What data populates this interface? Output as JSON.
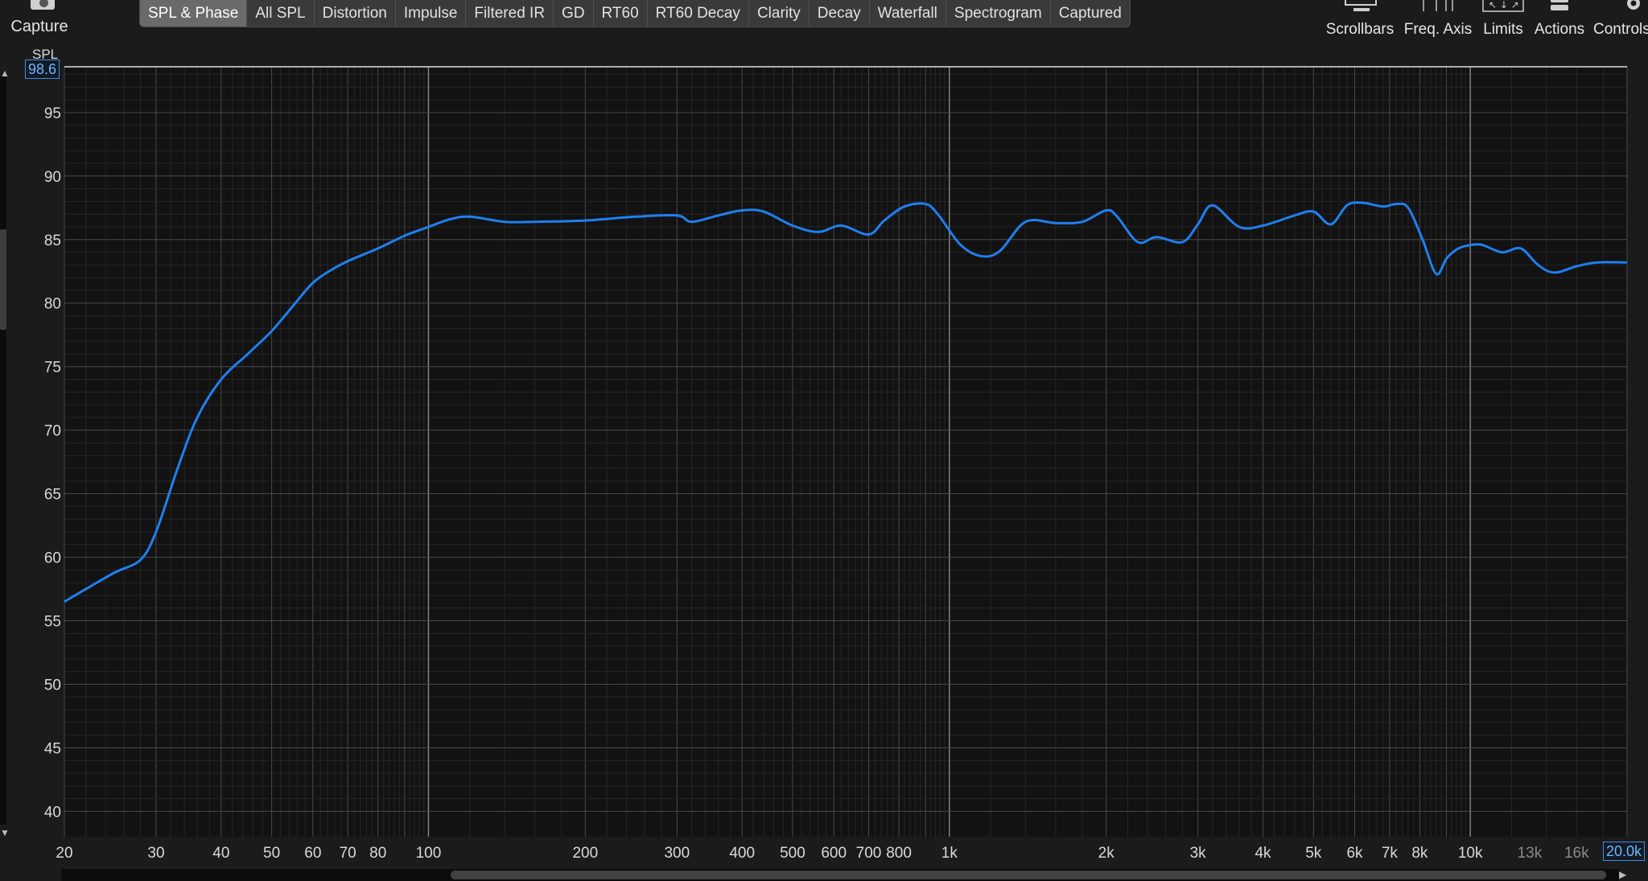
{
  "toolbar": {
    "capture_label": "Capture",
    "tabs": [
      {
        "label": "SPL & Phase",
        "active": true
      },
      {
        "label": "All SPL",
        "active": false
      },
      {
        "label": "Distortion",
        "active": false
      },
      {
        "label": "Impulse",
        "active": false
      },
      {
        "label": "Filtered IR",
        "active": false
      },
      {
        "label": "GD",
        "active": false
      },
      {
        "label": "RT60",
        "active": false
      },
      {
        "label": "RT60 Decay",
        "active": false
      },
      {
        "label": "Clarity",
        "active": false
      },
      {
        "label": "Decay",
        "active": false
      },
      {
        "label": "Waterfall",
        "active": false
      },
      {
        "label": "Spectrogram",
        "active": false
      },
      {
        "label": "Captured",
        "active": false
      }
    ],
    "right_tools": {
      "scrollbars": "Scrollbars",
      "freq_axis": "Freq. Axis",
      "limits": "Limits",
      "actions": "Actions",
      "controls": "Controls"
    }
  },
  "graph": {
    "y_axis_title": "SPL",
    "y_max_value": "98.6",
    "x_max_value": "20.0k",
    "y_tick_labels": [
      "95",
      "90",
      "85",
      "80",
      "75",
      "70",
      "65",
      "60",
      "55",
      "50",
      "45",
      "40"
    ],
    "x_tick_labels": [
      "20",
      "30",
      "40",
      "50",
      "60",
      "70",
      "80",
      "100",
      "200",
      "300",
      "400",
      "500",
      "600",
      "700",
      "800",
      "1k",
      "2k",
      "3k",
      "4k",
      "5k",
      "6k",
      "7k",
      "8k",
      "10k",
      "13k",
      "16k"
    ],
    "colors": {
      "background": "#121212",
      "trace": "#1f7ff0",
      "grid_major": "#4a4a4a",
      "grid_minor": "#262626"
    }
  },
  "chart_data": {
    "type": "line",
    "x_scale": "log",
    "xlim": [
      20,
      20000
    ],
    "ylim": [
      38,
      98.6
    ],
    "grid": true,
    "xlabel": "",
    "ylabel": "SPL",
    "series": [
      {
        "x": [
          20,
          22,
          25,
          28,
          30,
          33,
          36,
          40,
          45,
          50,
          55,
          60,
          65,
          70,
          80,
          90,
          100,
          110,
          120,
          140,
          160,
          200,
          250,
          300,
          320,
          360,
          400,
          440,
          500,
          560,
          620,
          700,
          750,
          820,
          900,
          950,
          1050,
          1150,
          1250,
          1400,
          1600,
          1800,
          2000,
          2100,
          2300,
          2500,
          2800,
          3000,
          3200,
          3600,
          4000,
          4600,
          5000,
          5400,
          5800,
          6200,
          6800,
          7200,
          7600,
          8100,
          8600,
          9000,
          9400,
          9800,
          10500,
          11500,
          12500,
          13500,
          14500,
          16000,
          17500,
          20000
        ],
        "y": [
          56.5,
          57.5,
          58.8,
          59.8,
          62.0,
          67.0,
          71.0,
          74.0,
          76.0,
          77.8,
          79.8,
          81.6,
          82.6,
          83.3,
          84.3,
          85.3,
          86.0,
          86.6,
          86.8,
          86.4,
          86.4,
          86.5,
          86.8,
          86.9,
          86.4,
          86.9,
          87.3,
          87.2,
          86.1,
          85.6,
          86.1,
          85.4,
          86.5,
          87.6,
          87.8,
          87.0,
          84.6,
          83.7,
          84.1,
          86.4,
          86.3,
          86.4,
          87.3,
          86.8,
          84.8,
          85.2,
          84.8,
          86.2,
          87.7,
          86.0,
          86.1,
          86.9,
          87.2,
          86.2,
          87.7,
          87.9,
          87.6,
          87.8,
          87.5,
          85.0,
          82.3,
          83.5,
          84.2,
          84.5,
          84.6,
          84.0,
          84.3,
          83.0,
          82.4,
          82.9,
          83.2,
          83.2
        ]
      }
    ]
  }
}
